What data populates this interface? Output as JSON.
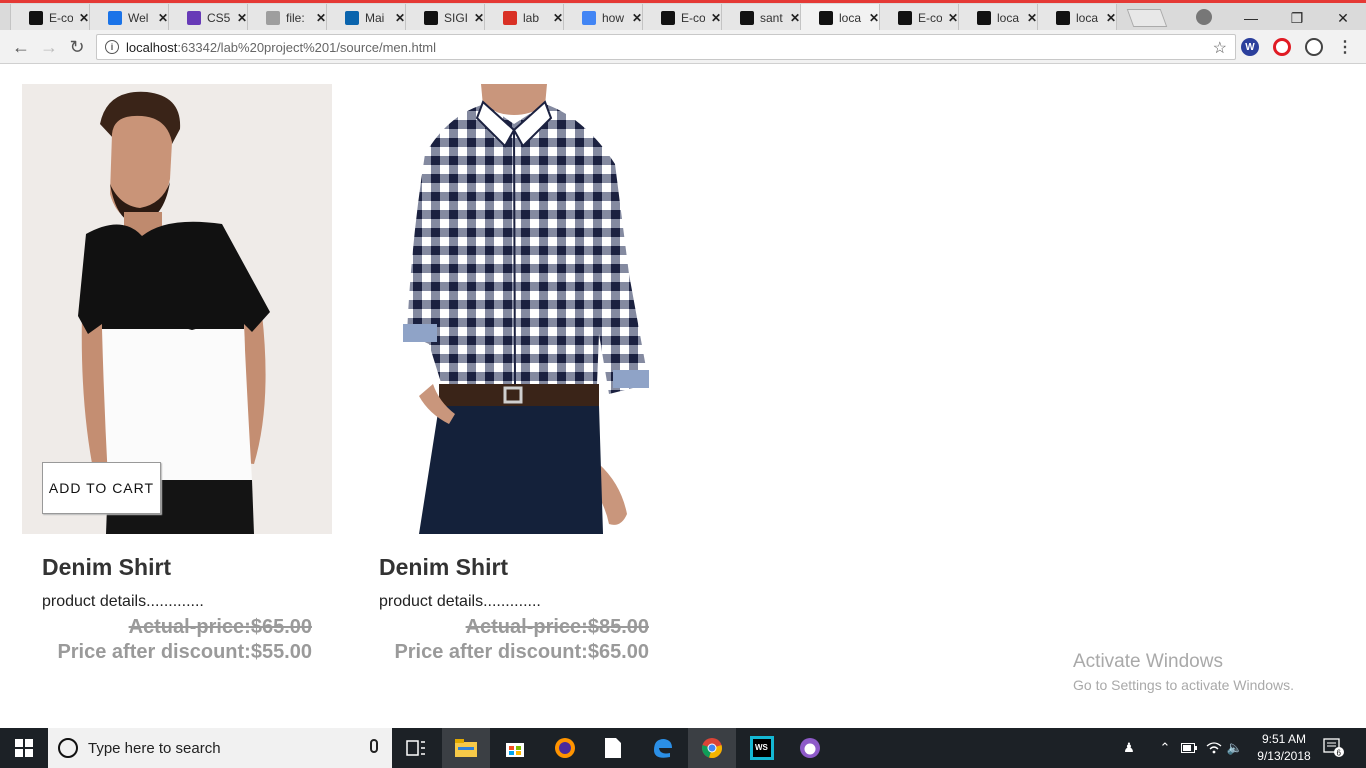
{
  "browser": {
    "tabs": [
      {
        "label": "E-co",
        "icon": "webstorm-icon",
        "color": "#111111"
      },
      {
        "label": "Wel",
        "icon": "box-icon",
        "color": "#1a73e8"
      },
      {
        "label": "CS5",
        "icon": "forms-icon",
        "color": "#673ab7"
      },
      {
        "label": "file:",
        "icon": "file-icon",
        "color": "#9e9e9e"
      },
      {
        "label": "Mai",
        "icon": "outlook-icon",
        "color": "#0a64ad"
      },
      {
        "label": "SIGI",
        "icon": "webstorm-icon",
        "color": "#111111"
      },
      {
        "label": "lab",
        "icon": "gmail-icon",
        "color": "#d93025"
      },
      {
        "label": "how",
        "icon": "google-icon",
        "color": "#4285f4"
      },
      {
        "label": "E-co",
        "icon": "webstorm-icon",
        "color": "#111111"
      },
      {
        "label": "sant",
        "icon": "github-icon",
        "color": "#111111"
      },
      {
        "label": "loca",
        "icon": "webstorm-icon",
        "color": "#111111"
      },
      {
        "label": "E-co",
        "icon": "webstorm-icon",
        "color": "#111111"
      },
      {
        "label": "loca",
        "icon": "webstorm-icon",
        "color": "#111111"
      },
      {
        "label": "loca",
        "icon": "webstorm-icon",
        "color": "#111111"
      }
    ],
    "active_tab": 10,
    "url_host": "localhost",
    "url_path": ":63342/lab%20project%201/source/men.html",
    "close_glyph": "✕"
  },
  "products": [
    {
      "name": "Denim Shirt",
      "details": "product details.............",
      "actual_price": "Actual-price:$65.00",
      "discount_price": "Price after discount:$55.00",
      "cart_label": "ADD TO CART"
    },
    {
      "name": "Denim Shirt",
      "details": "product details.............",
      "actual_price": "Actual-price:$85.00",
      "discount_price": "Price after discount:$65.00"
    }
  ],
  "watermark": {
    "line1": "Activate Windows",
    "line2": "Go to Settings to activate Windows."
  },
  "taskbar": {
    "search_placeholder": "Type here to search",
    "time": "9:51 AM",
    "date": "9/13/2018",
    "notification_count": "6"
  }
}
